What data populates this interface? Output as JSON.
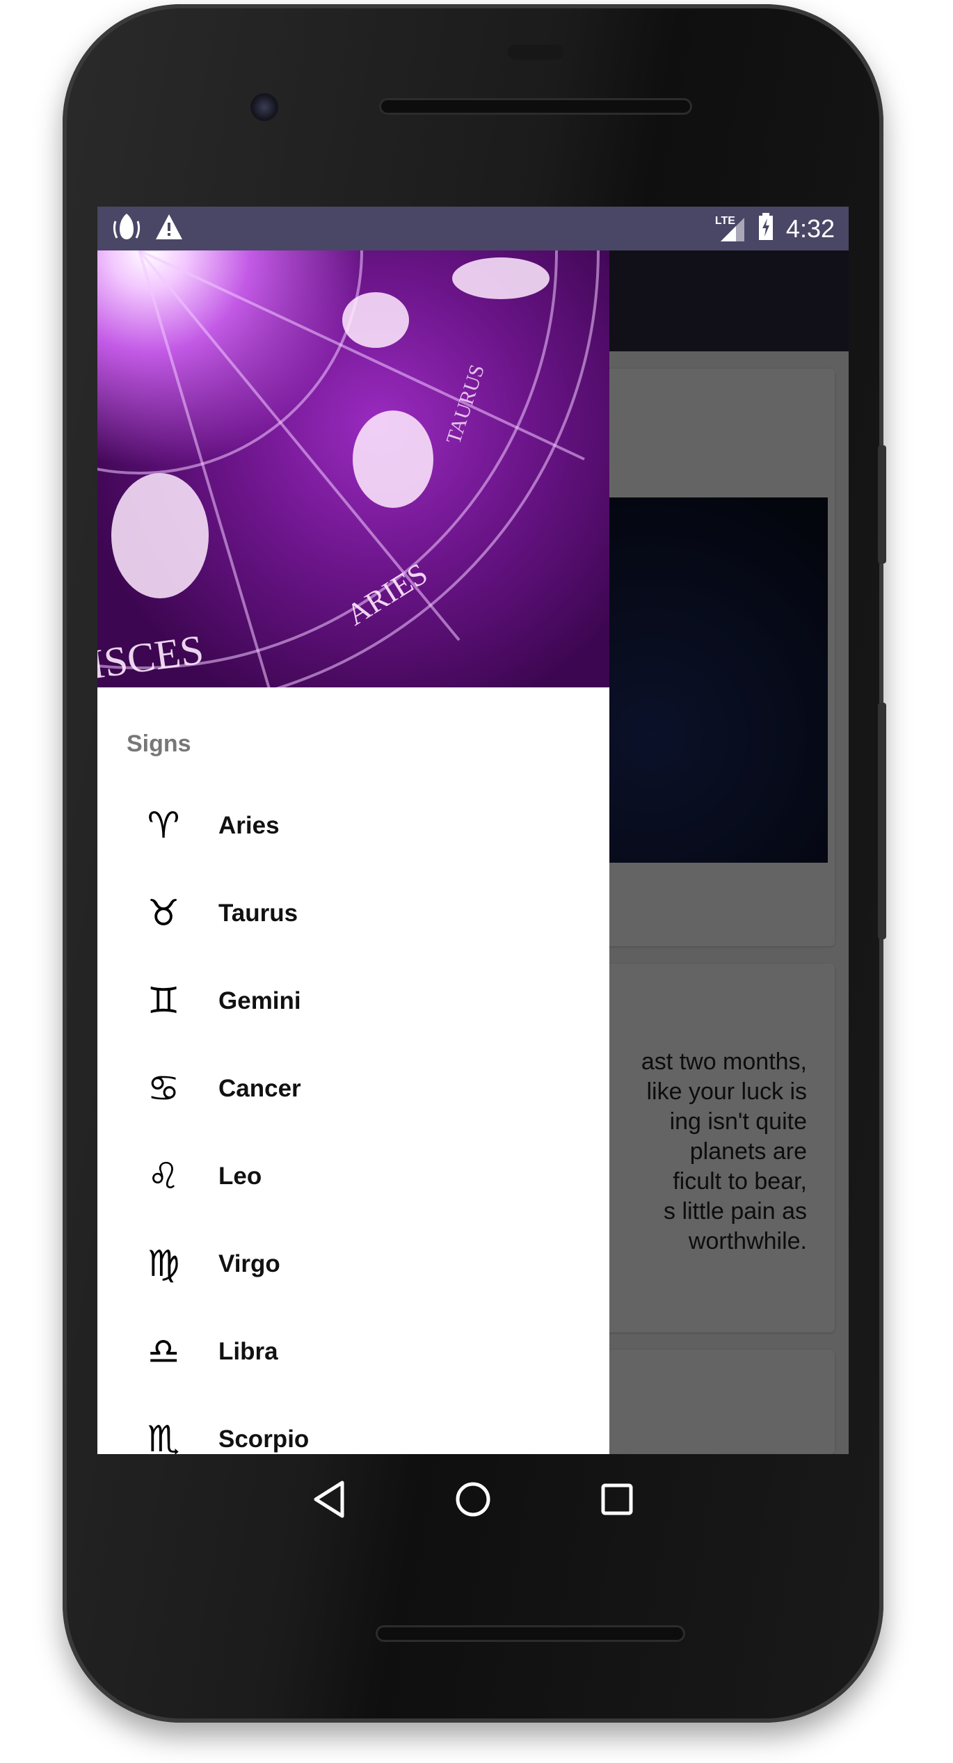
{
  "status_bar": {
    "left_icons": [
      "android-debug-icon",
      "warning-icon"
    ],
    "network": "LTE",
    "time": "4:32"
  },
  "drawer": {
    "header_image": "zodiac-wheel-purple",
    "header_image_labels": [
      "ARIES",
      "TAURUS",
      "PISCES"
    ],
    "section_label": "Signs",
    "items": [
      {
        "glyph": "♈",
        "label": "Aries",
        "icon": "aries-icon"
      },
      {
        "glyph": "♉",
        "label": "Taurus",
        "icon": "taurus-icon"
      },
      {
        "glyph": "♊",
        "label": "Gemini",
        "icon": "gemini-icon"
      },
      {
        "glyph": "♋",
        "label": "Cancer",
        "icon": "cancer-icon"
      },
      {
        "glyph": "♌",
        "label": "Leo",
        "icon": "leo-icon"
      },
      {
        "glyph": "♍",
        "label": "Virgo",
        "icon": "virgo-icon"
      },
      {
        "glyph": "♎",
        "label": "Libra",
        "icon": "libra-icon"
      },
      {
        "glyph": "♏",
        "label": "Scorpio",
        "icon": "scorpio-icon"
      }
    ]
  },
  "background_content": {
    "card2_text_lines": [
      "ast two months,",
      "like your luck is",
      "ing isn't quite",
      "planets are",
      "ficult to bear,",
      "s little pain as",
      "worthwhile."
    ]
  },
  "nav_bar": {
    "back": "back-icon",
    "home": "home-icon",
    "recents": "recents-icon"
  }
}
